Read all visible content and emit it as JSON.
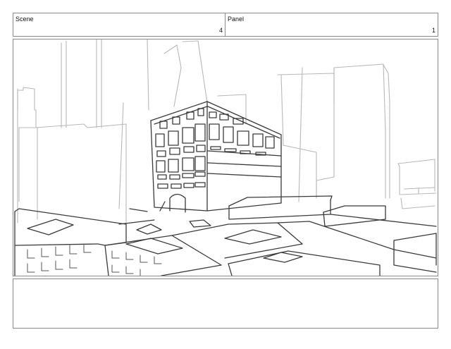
{
  "header": {
    "scene_label": "Scene",
    "scene_value": "4",
    "panel_label": "Panel",
    "panel_value": "1"
  },
  "frame": {
    "content": "city-street-sketch",
    "stroke_color": "#555555",
    "background_color": "#b8b8b8"
  },
  "notes": {
    "text": ""
  }
}
